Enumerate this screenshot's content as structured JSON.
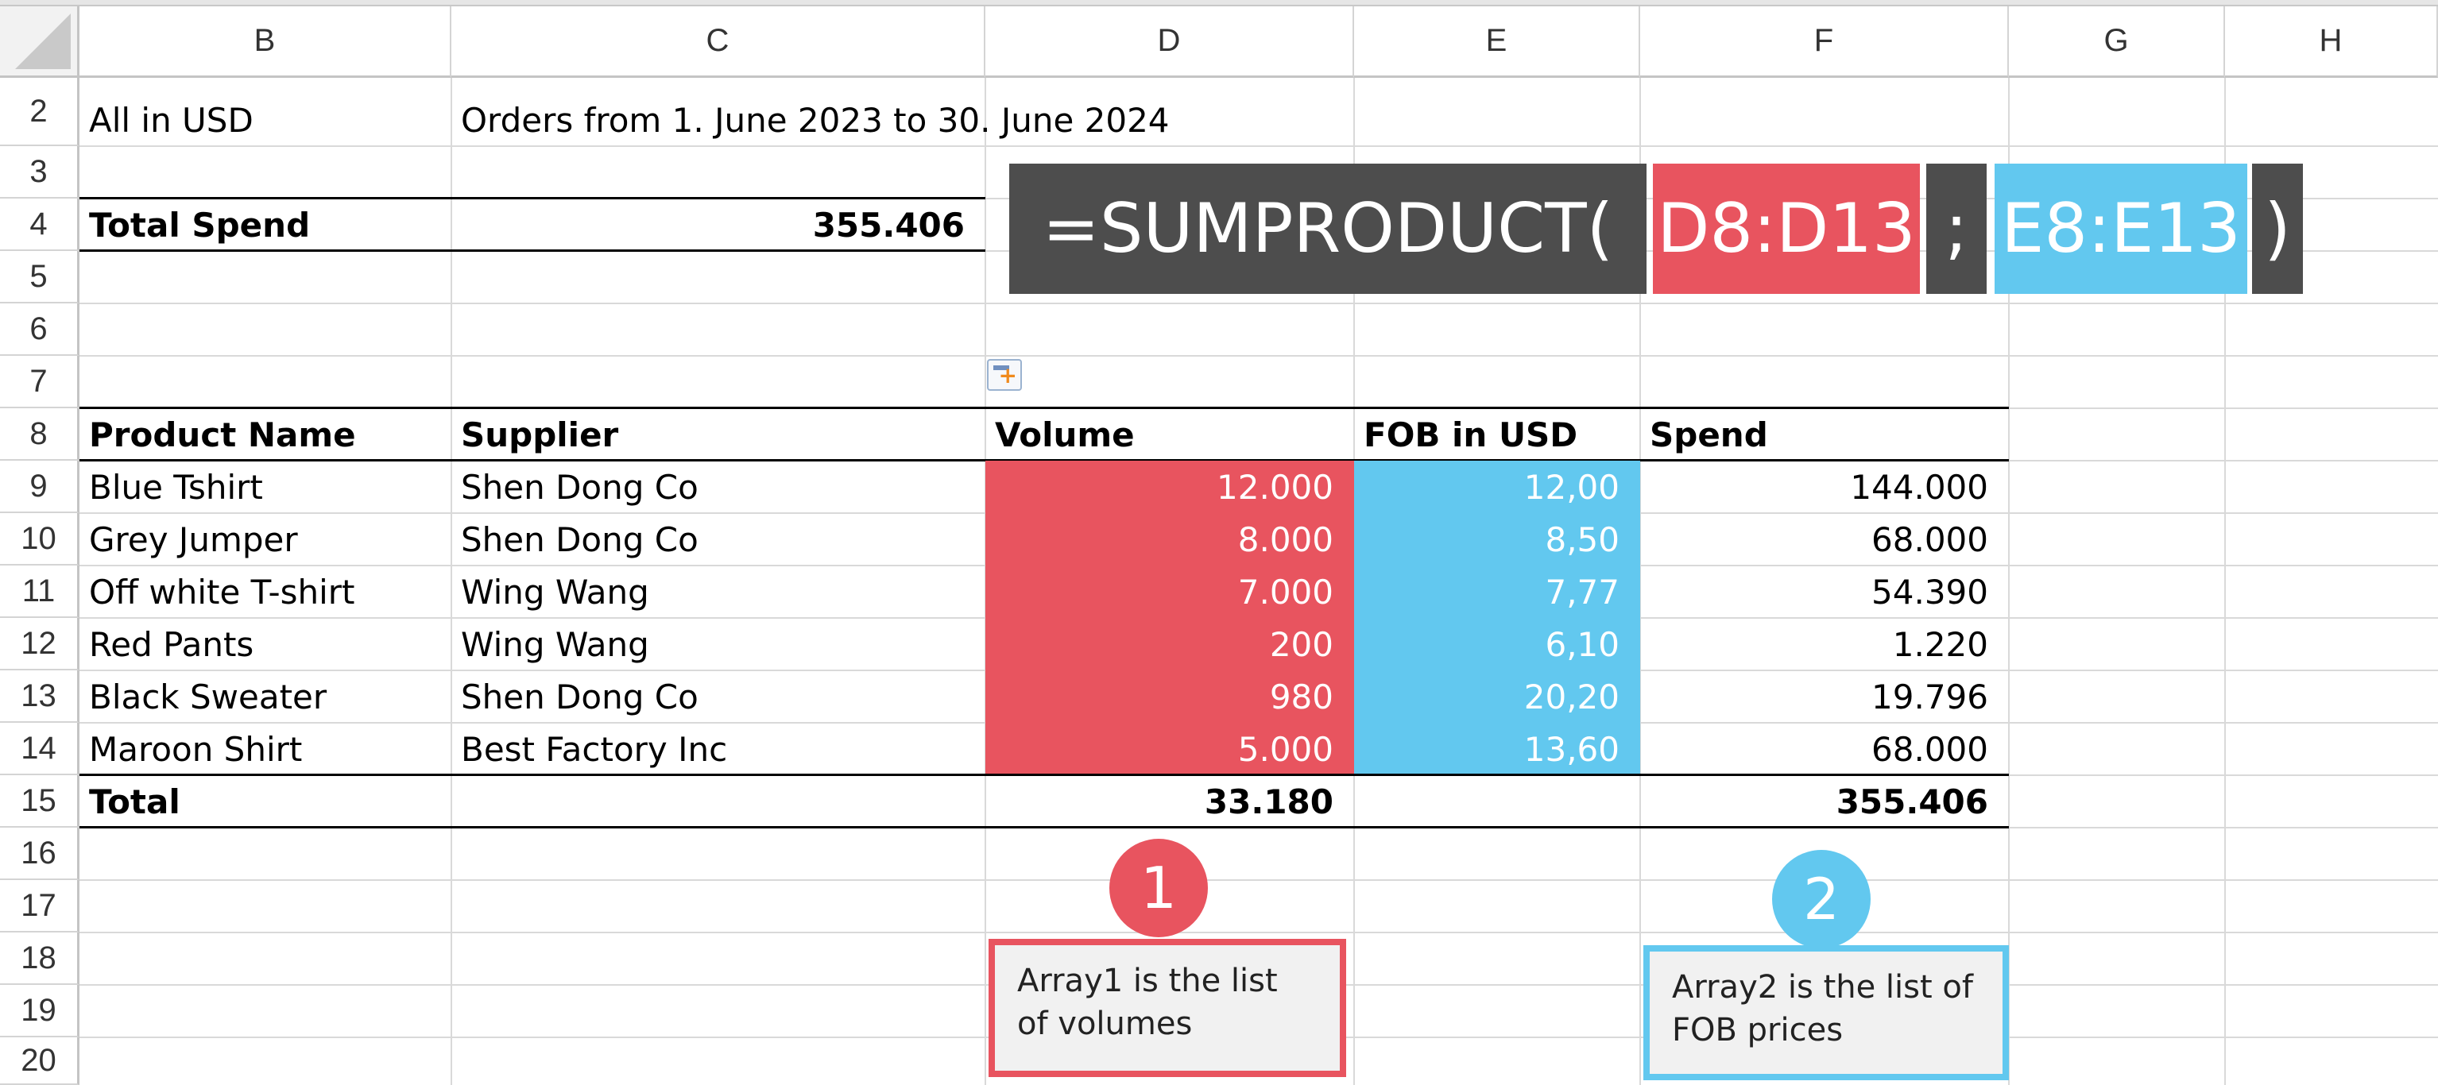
{
  "columns": [
    "B",
    "C",
    "D",
    "E",
    "F",
    "G",
    "H"
  ],
  "rows": [
    "2",
    "3",
    "4",
    "5",
    "6",
    "7",
    "8",
    "9",
    "10",
    "11",
    "12",
    "13",
    "14",
    "15",
    "16",
    "17",
    "18",
    "19",
    "20"
  ],
  "sheet": {
    "b2": "All in USD",
    "c2": "Orders from 1. June 2023 to 30. June 2024",
    "b4": "Total Spend",
    "c4": "355.406"
  },
  "table": {
    "headers": [
      "Product Name",
      "Supplier",
      "Volume",
      "FOB in USD",
      "Spend"
    ],
    "rows": [
      [
        "Blue Tshirt",
        "Shen Dong Co",
        "12.000",
        "12,00",
        "144.000"
      ],
      [
        "Grey Jumper",
        "Shen Dong Co",
        "8.000",
        "8,50",
        "68.000"
      ],
      [
        "Off white T-shirt",
        "Wing Wang",
        "7.000",
        "7,77",
        "54.390"
      ],
      [
        "Red Pants",
        "Wing Wang",
        "200",
        "6,10",
        "1.220"
      ],
      [
        "Black Sweater",
        "Shen Dong Co",
        "980",
        "20,20",
        "19.796"
      ],
      [
        "Maroon Shirt",
        "Best Factory Inc",
        "5.000",
        "13,60",
        "68.000"
      ]
    ],
    "total_label": "Total",
    "total_volume": "33.180",
    "total_spend": "355.406"
  },
  "formula": {
    "func": "=SUMPRODUCT(",
    "array1": "D8:D13",
    "sep": ";",
    "array2": "E8:E13",
    "close": ")"
  },
  "callouts": [
    {
      "number": "1",
      "text": "Array1 is the list of volumes"
    },
    {
      "number": "2",
      "text": "Array2 is the list of FOB prices"
    }
  ],
  "colors": {
    "array1": "#e8545f",
    "array2": "#62c8ef",
    "formula_bg": "#4d4d4d"
  },
  "icons": {
    "paste_options": "paste-options-icon"
  }
}
